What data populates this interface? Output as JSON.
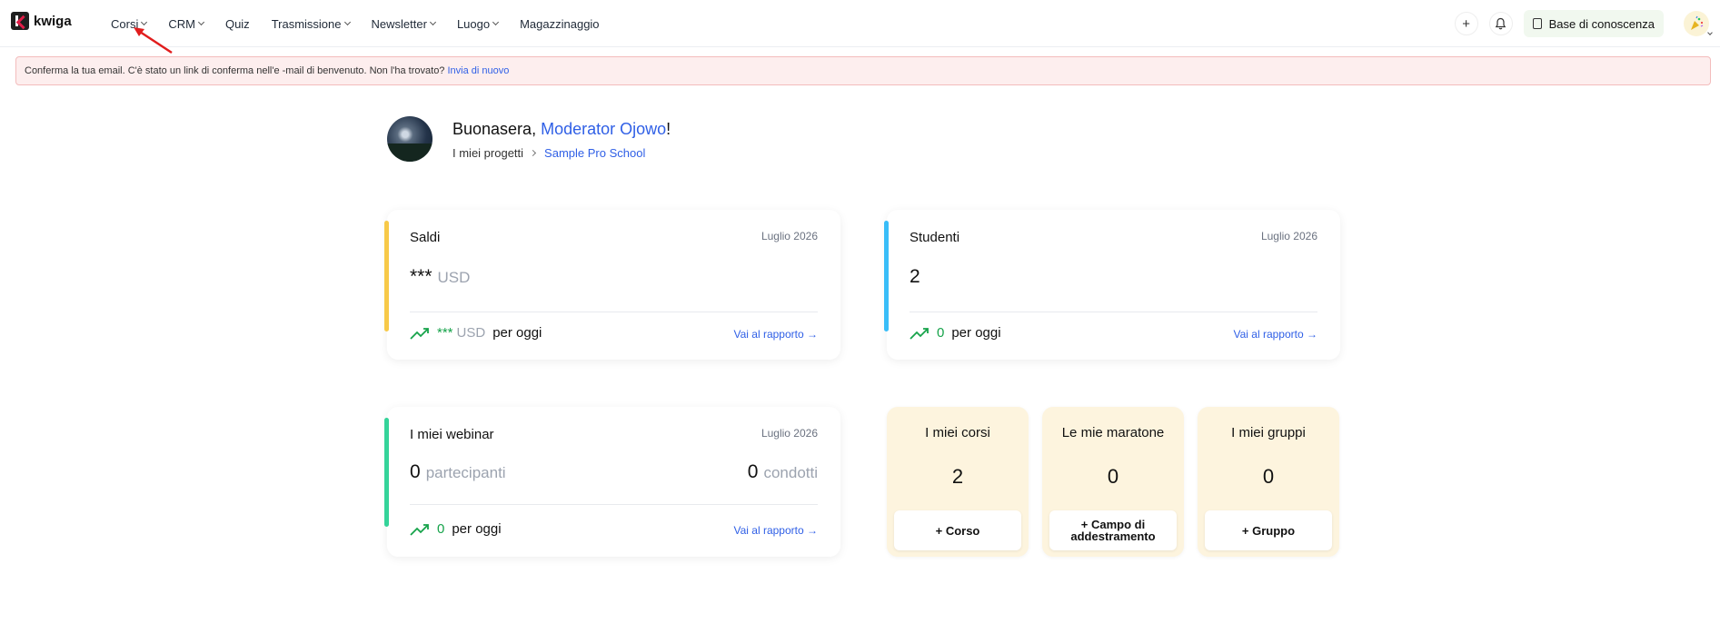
{
  "app": {
    "brand": "kwiga"
  },
  "nav": {
    "items": [
      {
        "label": "Corsi",
        "dropdown": true
      },
      {
        "label": "CRM",
        "dropdown": true
      },
      {
        "label": "Quiz",
        "dropdown": false
      },
      {
        "label": "Trasmissione",
        "dropdown": true
      },
      {
        "label": "Newsletter",
        "dropdown": true
      },
      {
        "label": "Luogo",
        "dropdown": true
      },
      {
        "label": "Magazzinaggio",
        "dropdown": false
      }
    ]
  },
  "topright": {
    "add_icon": "+",
    "bell_icon": "bell-icon",
    "knowledge_base_label": "Base di conoscenza",
    "avatar_icon": "party-popper-icon"
  },
  "alert": {
    "text": "Conferma la tua email. C'è stato un link di conferma nell'e -mail di benvenuto. Non l'ha trovato?",
    "link": "Invia di nuovo",
    "colors": {
      "background": "#fdeeee",
      "border": "#f3bcbc"
    }
  },
  "greeting": {
    "prefix": "Buonasera,",
    "name": "Moderator Ojowo",
    "suffix": "!",
    "breadcrumb_root": "I miei progetti",
    "breadcrumb_current": "Sample Pro School"
  },
  "cards": {
    "balance": {
      "title": "Saldi",
      "date": "Luglio 2026",
      "value": "***",
      "unit": "USD",
      "today_value": "***",
      "today_unit": "USD",
      "today_label": "per oggi",
      "link": "Vai al rapporto →",
      "accent": "#f7c948"
    },
    "students": {
      "title": "Studenti",
      "date": "Luglio 2026",
      "value": "2",
      "today_value": "0",
      "today_label": "per oggi",
      "link": "Vai al rapporto →",
      "accent": "#38bdf8"
    },
    "webinars": {
      "title": "I miei webinar",
      "date": "Luglio 2026",
      "participants_value": "0",
      "participants_label": "partecipanti",
      "held_value": "0",
      "held_label": "condotti",
      "today_value": "0",
      "today_label": "per oggi",
      "link": "Vai al rapporto →",
      "accent": "#34d399"
    }
  },
  "counters": [
    {
      "title": "I miei corsi",
      "value": "2",
      "button": "+ Corso"
    },
    {
      "title": "Le mie maratone",
      "value": "0",
      "button": "+ Campo di addestramento"
    },
    {
      "title": "I miei gruppi",
      "value": "0",
      "button": "+ Gruppo"
    }
  ],
  "colors": {
    "link": "#2f5fe6",
    "trend_green": "#16a34a",
    "counter_bg": "#fdf4de"
  }
}
